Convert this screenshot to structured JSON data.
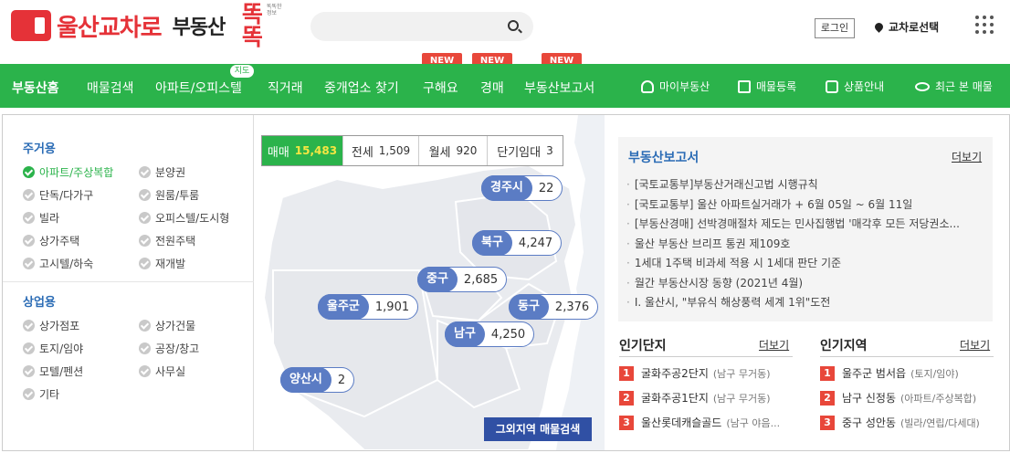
{
  "header": {
    "logo_text": "울산교차로",
    "logo_sub": "부동산",
    "logo_ttuk": "똑똑",
    "logo_small": "똑똑한 정보",
    "search_placeholder": "",
    "login_label": "로그인",
    "region_label": "교차로선택"
  },
  "nav": {
    "items": [
      "부동산홈",
      "매물검색",
      "아파트/오피스텔",
      "직거래",
      "중개업소 찾기",
      "구해요",
      "경매",
      "부동산보고서"
    ],
    "map_badge": "지도",
    "new_label": "NEW",
    "right": [
      "마이부동산",
      "매물등록",
      "상품안내",
      "최근 본 매물"
    ]
  },
  "categories": {
    "residential_title": "주거용",
    "residential": [
      "아파트/주상복합",
      "분양권",
      "단독/다가구",
      "원룸/투룸",
      "빌라",
      "오피스텔/도시형",
      "상가주택",
      "전원주택",
      "고시텔/하숙",
      "재개발"
    ],
    "commercial_title": "상업용",
    "commercial": [
      "상가점포",
      "상가건물",
      "토지/임야",
      "공장/창고",
      "모텔/펜션",
      "사무실",
      "기타"
    ]
  },
  "map": {
    "tabs": [
      {
        "label": "매매",
        "count": "15,483"
      },
      {
        "label": "전세",
        "count": "1,509"
      },
      {
        "label": "월세",
        "count": "920"
      },
      {
        "label": "단기임대",
        "count": "3"
      }
    ],
    "districts": [
      {
        "name": "경주시",
        "count": "22"
      },
      {
        "name": "북구",
        "count": "4,247"
      },
      {
        "name": "중구",
        "count": "2,685"
      },
      {
        "name": "울주군",
        "count": "1,901"
      },
      {
        "name": "동구",
        "count": "2,376"
      },
      {
        "name": "남구",
        "count": "4,250"
      },
      {
        "name": "양산시",
        "count": "2"
      }
    ],
    "other_button": "그외지역 매물검색"
  },
  "report": {
    "title": "부동산보고서",
    "more": "더보기",
    "items": [
      "[국토교통부]부동산거래신고법 시행규칙",
      "[국토교통부] 울산 아파트실거래가 + 6월 05일 ~ 6월 11일",
      "[부동산경매] 선박경매절차 제도는 민사집행법 '매각후 모든 저당권소...",
      "울산 부동산 브리프 통권 제109호",
      "1세대 1주택 비과세 적용 시 1세대 판단 기준",
      "월간 부동산시장 동향 (2021년 4월)",
      "Ⅰ. 울산시, \"부유식 해상풍력 세계 1위\"도전"
    ]
  },
  "popular_complex": {
    "title": "인기단지",
    "more": "더보기",
    "items": [
      {
        "rank": "1",
        "name": "굴화주공2단지",
        "sub": "(남구 무거동)"
      },
      {
        "rank": "2",
        "name": "굴화주공1단지",
        "sub": "(남구 무거동)"
      },
      {
        "rank": "3",
        "name": "울산롯데캐슬골드",
        "sub": "(남구 야음..."
      }
    ]
  },
  "popular_region": {
    "title": "인기지역",
    "more": "더보기",
    "items": [
      {
        "rank": "1",
        "name": "울주군 범서읍",
        "sub": "(토지/임야)"
      },
      {
        "rank": "2",
        "name": "남구 신정동",
        "sub": "(아파트/주상복합)"
      },
      {
        "rank": "3",
        "name": "중구 성안동",
        "sub": "(빌라/연립/다세대)"
      }
    ]
  },
  "colors": {
    "brand_red": "#e53238",
    "nav_green": "#2bb34b",
    "link_blue": "#2b6cb5",
    "pill_blue": "#5b7cc4",
    "new_badge": "#e8473a"
  }
}
